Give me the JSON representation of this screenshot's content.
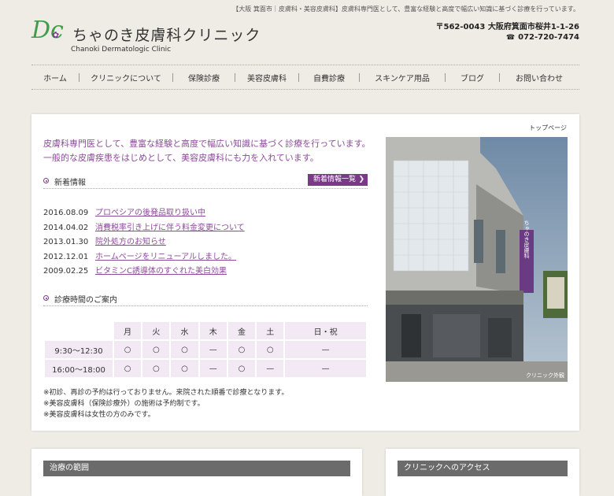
{
  "header": {
    "tagline": "【大阪 箕面市｜皮膚科・美容皮膚科】皮膚科専門医として、豊富な経験と高度で幅広い知識に基づく診療を行っています。",
    "logo_mark": "Dc",
    "logo_ja": "ちゃのき皮膚科クリニック",
    "logo_en": "Chanoki Dermatologic Clinic",
    "address": "〒562-0043 大阪府箕面市桜井1-1-26",
    "phone": "072-720-7474"
  },
  "nav": [
    {
      "label": "ホーム"
    },
    {
      "label": "クリニックについて"
    },
    {
      "label": "保険診療"
    },
    {
      "label": "美容皮膚科"
    },
    {
      "label": "自費診療"
    },
    {
      "label": "スキンケア用品"
    },
    {
      "label": "ブログ"
    },
    {
      "label": "お問い合わせ"
    }
  ],
  "main": {
    "breadcrumb": "トップページ",
    "intro_line1": "皮膚科専門医として、豊富な経験と高度で幅広い知識に基づく診療を行っています。",
    "intro_line2": "一般的な皮膚疾患をはじめとして、美容皮膚科にも力を入れています。",
    "news_title": "新着情報",
    "news_button": "新着情報一覧",
    "news": [
      {
        "date": "2016.08.09",
        "title": "プロペシアの後発品取り扱い中"
      },
      {
        "date": "2014.04.02",
        "title": "消費税率引き上げに伴う料金変更について"
      },
      {
        "date": "2013.01.30",
        "title": "院外処方のお知らせ"
      },
      {
        "date": "2012.12.01",
        "title": "ホームページをリニューアルしました。"
      },
      {
        "date": "2009.02.25",
        "title": "ビタミンC誘導体のすぐれた美白効果"
      }
    ],
    "hours_title": "診療時間のご案内",
    "hours": {
      "days": [
        "月",
        "火",
        "水",
        "木",
        "金",
        "土",
        "日・祝"
      ],
      "rows": [
        {
          "time": "9:30〜12:30",
          "cells": [
            "○",
            "○",
            "○",
            "—",
            "○",
            "○",
            "—"
          ]
        },
        {
          "time": "16:00〜18:00",
          "cells": [
            "○",
            "○",
            "○",
            "—",
            "○",
            "—",
            "—"
          ]
        }
      ]
    },
    "notes": [
      "※初診、再診の予約は行っておりません。来院された順番で診療となります。",
      "※美容皮膚科（保険診療外）の施術は予約制です。",
      "※美容皮膚科は女性の方のみです。"
    ],
    "photo_caption": "クリニック外観",
    "sign_text": "ちゃのき皮膚科"
  },
  "bottom": {
    "treatment_title": "治療の範囲",
    "access_title": "クリニックへのアクセス"
  }
}
